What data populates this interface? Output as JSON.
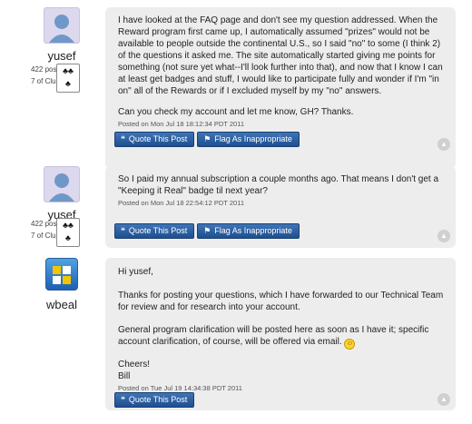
{
  "posts": [
    {
      "author": "yusef",
      "posts_count": "422 posts",
      "clubs": "7 of Clubs",
      "paragraphs": [
        "I have looked at the FAQ page and don't see my question addressed. When the Reward program first came up, I automatically assumed \"prizes\" would not be available to people outside the continental U.S., so I said \"no\" to some (I think 2) of the questions it asked me. The site automatically started giving me points for something (not sure yet what--I'll look further into that), and now that I know I can at least get badges and stuff, I would like to participate fully and wonder if I'm \"in on\" all of the Rewards or if I excluded myself by my \"no\" answers.",
        "Can you check my account and let me know, GH? Thanks."
      ],
      "posted": "Posted on Mon Jul 18 18:12:34 PDT 2011",
      "quote_label": "Quote This Post",
      "flag_label": "Flag As Inappropriate"
    },
    {
      "author": "yusef",
      "posts_count": "422 posts",
      "clubs": "7 of Clubs",
      "paragraphs": [
        "So I paid my annual subscription a couple months ago. That means I don't get a \"Keeping it Real\" badge til next year?"
      ],
      "posted": "Posted on Mon Jul 18 22:54:12 PDT 2011",
      "quote_label": "Quote This Post",
      "flag_label": "Flag As Inappropriate"
    },
    {
      "author": "wbeal",
      "greeting": "Hi yusef,",
      "p1": "Thanks for posting your questions, which I have forwarded to our Technical Team for review and for research into your account.",
      "p2": "General program clarification will be posted here as soon as I have it; specific account clarification, of course, will be offered via email.",
      "sign1": "Cheers!",
      "sign2": "Bill",
      "posted": "Posted on Tue Jul 19 14:34:38 PDT 2011",
      "quote_label": "Quote This Post"
    }
  ],
  "icons": {
    "quote": "quote-icon",
    "flag": "flag-icon",
    "scroll": "chevron-up-icon",
    "card": "playing-card-icon",
    "smiley": "smiley-icon"
  },
  "colors": {
    "button": "#2a5d9f",
    "bubble": "#ededed",
    "avatar_bg": "#dcd8ee"
  }
}
